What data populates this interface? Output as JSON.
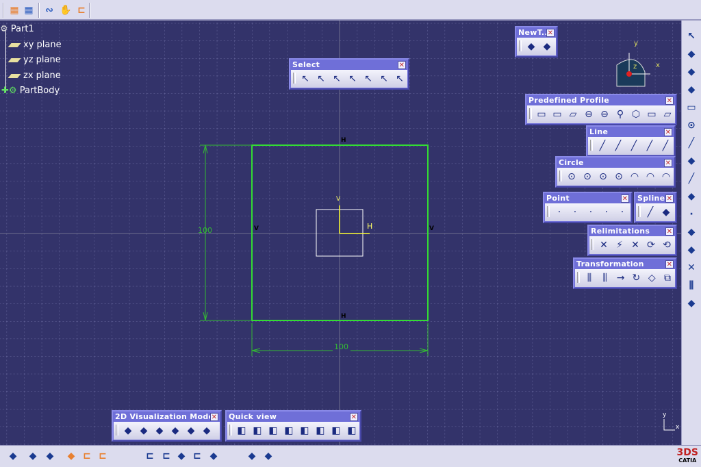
{
  "top_toolbar": {
    "icons": [
      "grid-icon",
      "snap-to-point-icon",
      "construction-elements-icon",
      "geometrical-constraints-icon",
      "dimensional-constraints-icon"
    ]
  },
  "tree": {
    "root": "Part1",
    "items": [
      "xy plane",
      "yz plane",
      "zx plane",
      "PartBody"
    ]
  },
  "compass": {
    "x": "x",
    "y": "y",
    "z": "z"
  },
  "sketch": {
    "dim_vertical": "100",
    "dim_horizontal": "100",
    "constraint_h": "H",
    "constraint_v": "V",
    "axis_h": "H",
    "axis_v": "V"
  },
  "toolbars": {
    "newt": {
      "title": "NewT...",
      "icons": [
        "new-tool-icon",
        "catalog-icon"
      ]
    },
    "select": {
      "title": "Select",
      "icons": [
        "select-arrow-icon",
        "select-box-icon",
        "select-intersect-icon",
        "select-polygon-icon",
        "select-freehand-icon",
        "select-outside-icon",
        "select-intersect-outside-icon"
      ]
    },
    "predefined_profile": {
      "title": "Predefined Profile",
      "icons": [
        "rectangle-icon",
        "oriented-rectangle-icon",
        "parallelogram-icon",
        "elongated-hole-icon",
        "cylindrical-elongated-hole-icon",
        "keyhole-icon",
        "hexagon-icon",
        "centered-rectangle-icon",
        "centered-parallelogram-icon"
      ]
    },
    "line": {
      "title": "Line",
      "icons": [
        "line-icon",
        "infinite-line-icon",
        "bi-tangent-line-icon",
        "bisecting-line-icon",
        "normal-line-icon"
      ]
    },
    "circle": {
      "title": "Circle",
      "icons": [
        "circle-icon",
        "three-point-circle-icon",
        "circle-coordinates-icon",
        "tri-tangent-circle-icon",
        "three-point-arc-icon",
        "three-point-arc-limits-icon",
        "arc-icon"
      ]
    },
    "point": {
      "title": "Point",
      "icons": [
        "point-icon",
        "point-coordinates-icon",
        "equidistant-points-icon",
        "intersection-point-icon",
        "projection-point-icon"
      ]
    },
    "spline": {
      "title": "Spline",
      "icons": [
        "spline-icon",
        "connect-icon"
      ]
    },
    "relimitations": {
      "title": "Relimitations",
      "icons": [
        "trim-icon",
        "break-icon",
        "quick-trim-icon",
        "close-icon",
        "complement-icon"
      ]
    },
    "transformation": {
      "title": "Transformation",
      "icons": [
        "mirror-icon",
        "symmetry-icon",
        "translate-icon",
        "rotate-icon",
        "scale-icon",
        "offset-icon"
      ]
    },
    "vis2d": {
      "title": "2D Visualization Mode",
      "icons": [
        "pickable-icon",
        "no-3d-background-icon",
        "unpickable-background-icon",
        "low-intensity-icon",
        "lock-elements-icon",
        "diagnosis-icon"
      ]
    },
    "quickview": {
      "title": "Quick view",
      "icons": [
        "isometric-view-icon",
        "front-view-icon",
        "back-view-icon",
        "left-view-icon",
        "right-view-icon",
        "top-view-icon",
        "bottom-view-icon",
        "named-views-icon"
      ]
    }
  },
  "right_toolbar": {
    "icons": [
      "select-icon",
      "exit-workbench-icon",
      "sketch-icon",
      "profile-icon",
      "rectangle-icon",
      "circle-icon",
      "spline-icon",
      "ellipse-icon",
      "line-icon",
      "axis-icon",
      "point-icon",
      "corner-icon",
      "chamfer-icon",
      "trim-icon",
      "mirror-icon",
      "project-3d-icon"
    ]
  },
  "bottom_toolbar": {
    "icons": [
      "sketch-analysis-icon",
      "cut-part-icon",
      "visualization-icon",
      "fix-together-icon",
      "auto-constraint-icon",
      "animate-constraint-icon",
      "constraint-icon",
      "edit-multi-constraint-icon",
      "update-icon",
      "hide-constraints-icon",
      "diagnosis-icon",
      "measure-icon",
      "scan-icon"
    ]
  },
  "corner_axes": {
    "x": "x",
    "y": "y"
  },
  "logo": "CATIA",
  "colors": {
    "background": "#33336a",
    "sketch": "#33dd33",
    "axis": "#ffff33",
    "toolbar_title": "#6f6fd8"
  }
}
